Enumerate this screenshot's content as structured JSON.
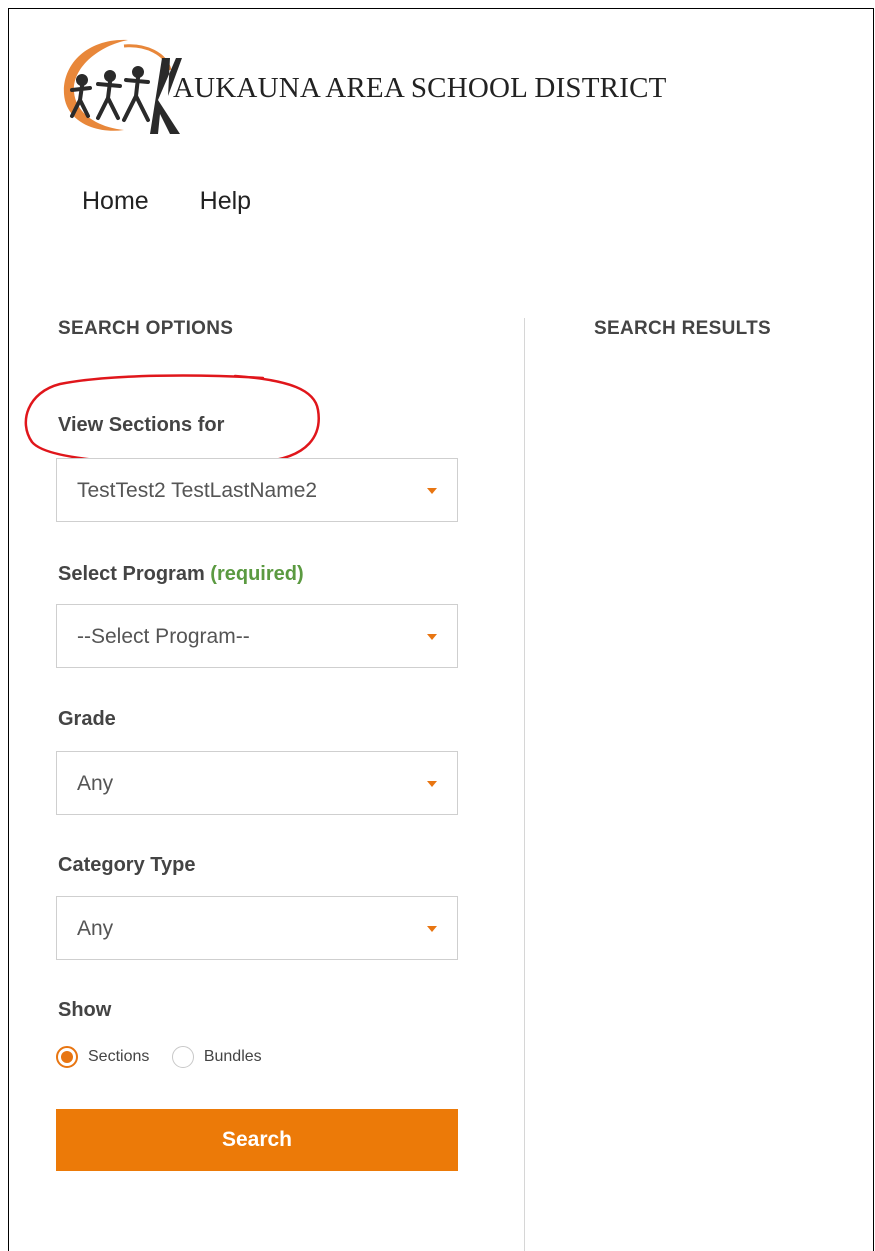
{
  "header": {
    "logo_text": "AUKAUNA AREA SCHOOL DISTRICT"
  },
  "nav": {
    "items": [
      {
        "label": "Home"
      },
      {
        "label": "Help"
      }
    ]
  },
  "search_options": {
    "title": "SEARCH OPTIONS",
    "view_sections_label": "View Sections for",
    "view_sections_value": "TestTest2 TestLastName2",
    "program_label": "Select Program",
    "program_required": "(required)",
    "program_value": "--Select Program--",
    "grade_label": "Grade",
    "grade_value": "Any",
    "category_label": "Category Type",
    "category_value": "Any",
    "show_label": "Show",
    "show_options": [
      {
        "label": "Sections",
        "selected": true
      },
      {
        "label": "Bundles",
        "selected": false
      }
    ],
    "search_button": "Search"
  },
  "search_results": {
    "title": "SEARCH RESULTS"
  },
  "colors": {
    "accent": "#ec7a08",
    "required": "#5b9a41",
    "annotation": "#e0161b"
  }
}
